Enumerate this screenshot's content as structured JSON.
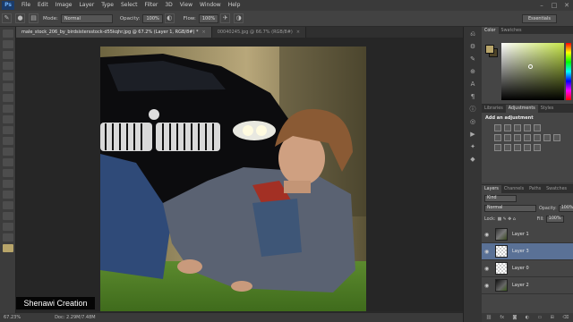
{
  "menubar": {
    "logo": "Ps",
    "items": [
      "File",
      "Edit",
      "Image",
      "Layer",
      "Type",
      "Select",
      "Filter",
      "3D",
      "View",
      "Window",
      "Help"
    ],
    "controls": [
      "–",
      "□",
      "✕"
    ]
  },
  "options": {
    "mode_label": "Mode:",
    "mode_value": "Normal",
    "opacity_label": "Opacity:",
    "opacity_value": "100%",
    "flow_label": "Flow:",
    "flow_value": "100%",
    "workspace": "Essentials"
  },
  "tabs": [
    {
      "label": "male_stock_206_by_birdsistersstock-d55kqhr.jpg @ 67.2% (Layer 1, RGB/8#) *",
      "active": true
    },
    {
      "label": "00040245.jpg @ 66.7% (RGB/8#)",
      "active": false
    }
  ],
  "status": {
    "zoom": "67.23%",
    "doc": "Doc: 2.29M/7.48M"
  },
  "watermark": "Shenawi Creation",
  "panels": {
    "color": {
      "tabs": [
        "Color",
        "Swatches"
      ],
      "fg": "#b8a56a",
      "bg": "#4e4428"
    },
    "adjustments": {
      "tabs": [
        "Libraries",
        "Adjustments",
        "Styles"
      ],
      "heading": "Add an adjustment"
    },
    "layers": {
      "tabs": [
        "Layers",
        "Channels",
        "Paths",
        "Swatches"
      ],
      "kind_label": "Kind",
      "blend_mode": "Normal",
      "opacity_label": "Opacity:",
      "opacity_value": "100%",
      "lock_label": "Lock:",
      "fill_label": "Fill:",
      "fill_value": "100%",
      "items": [
        {
          "name": "Layer 1",
          "selected": false,
          "thumb": "photo"
        },
        {
          "name": "Layer 3",
          "selected": true,
          "thumb": "checker"
        },
        {
          "name": "Layer 0",
          "selected": false,
          "thumb": "checker"
        },
        {
          "name": "Layer 2",
          "selected": false,
          "thumb": "photo2"
        }
      ],
      "footer_icons": [
        "link-icon",
        "fx-icon",
        "mask-icon",
        "adjustment-icon",
        "folder-icon",
        "new-layer-icon",
        "trash-icon"
      ]
    }
  }
}
